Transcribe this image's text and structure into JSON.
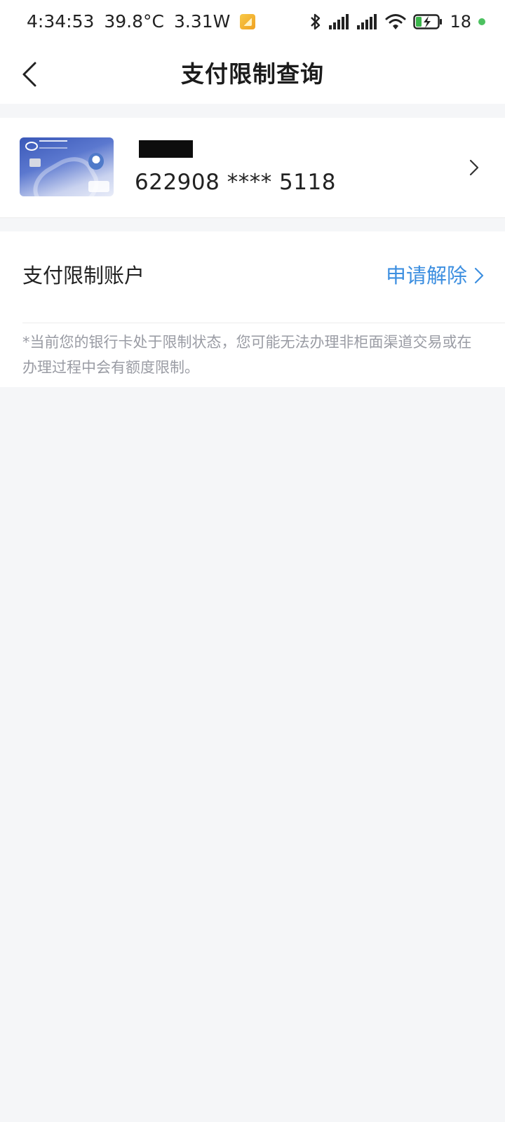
{
  "status_bar": {
    "time": "4:34:53",
    "temperature": "39.8°C",
    "power": "3.31W",
    "battery_level": "18",
    "icons": [
      "app-notification-icon",
      "bluetooth-icon",
      "signal-icon",
      "signal-icon",
      "wifi-icon",
      "battery-charging-icon"
    ]
  },
  "nav": {
    "title": "支付限制查询",
    "back_icon": "chevron-left-icon"
  },
  "card": {
    "number": "622908 **** 5118",
    "image_icon": "bank-card-image",
    "chevron_icon": "chevron-right-icon"
  },
  "restriction": {
    "label": "支付限制账户",
    "action_label": "申请解除",
    "action_color": "#3d8fe0",
    "note": "*当前您的银行卡处于限制状态，您可能无法办理非柜面渠道交易或在办理过程中会有额度限制。"
  }
}
